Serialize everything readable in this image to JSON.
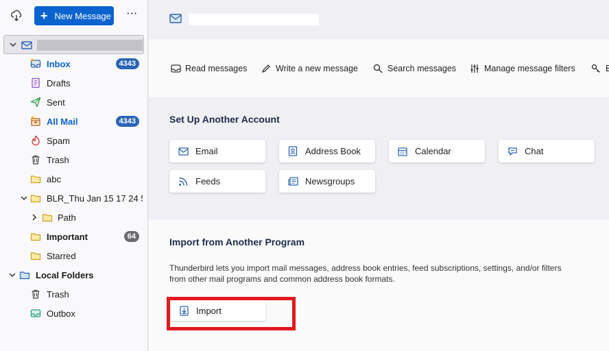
{
  "toolbar": {
    "new_message_label": "New Message",
    "more_label": "···"
  },
  "folders": {
    "inbox": {
      "label": "Inbox",
      "count": "4343"
    },
    "drafts": {
      "label": "Drafts"
    },
    "sent": {
      "label": "Sent"
    },
    "allmail": {
      "label": "All Mail",
      "count": "4343"
    },
    "spam": {
      "label": "Spam"
    },
    "trash": {
      "label": "Trash"
    },
    "abc": {
      "label": "abc"
    },
    "blr": {
      "label": "BLR_Thu Jan 15 17 24 5..."
    },
    "path": {
      "label": "Path"
    },
    "important": {
      "label": "Important",
      "count": "64"
    },
    "starred": {
      "label": "Starred"
    },
    "local": {
      "label": "Local Folders"
    },
    "local_trash": {
      "label": "Trash"
    },
    "outbox": {
      "label": "Outbox"
    }
  },
  "actions": {
    "read": "Read messages",
    "write": "Write a new message",
    "search": "Search messages",
    "filters": "Manage message filters",
    "e2e": "E"
  },
  "setup": {
    "title": "Set Up Another Account",
    "email": "Email",
    "address_book": "Address Book",
    "calendar": "Calendar",
    "chat": "Chat",
    "feeds": "Feeds",
    "newsgroups": "Newsgroups"
  },
  "import": {
    "title": "Import from Another Program",
    "description": "Thunderbird lets you import mail messages, address book entries, feed subscriptions, settings, and/or filters from other mail programs and common address book formats.",
    "button": "Import"
  },
  "colors": {
    "accent": "#0b63cf",
    "badge": "#2a64b6",
    "highlight": "#e0191f"
  },
  "icons": [
    "get-messages-icon",
    "plus-icon",
    "account-mail-icon",
    "inbox-icon",
    "drafts-icon",
    "sent-icon",
    "all-mail-icon",
    "spam-icon",
    "trash-icon",
    "folder-icon",
    "local-folders-icon",
    "outbox-icon",
    "envelope-icon",
    "pencil-icon",
    "search-icon",
    "filters-icon",
    "key-icon",
    "address-book-icon",
    "calendar-icon",
    "chat-icon",
    "feeds-icon",
    "newsgroups-icon",
    "import-icon"
  ]
}
